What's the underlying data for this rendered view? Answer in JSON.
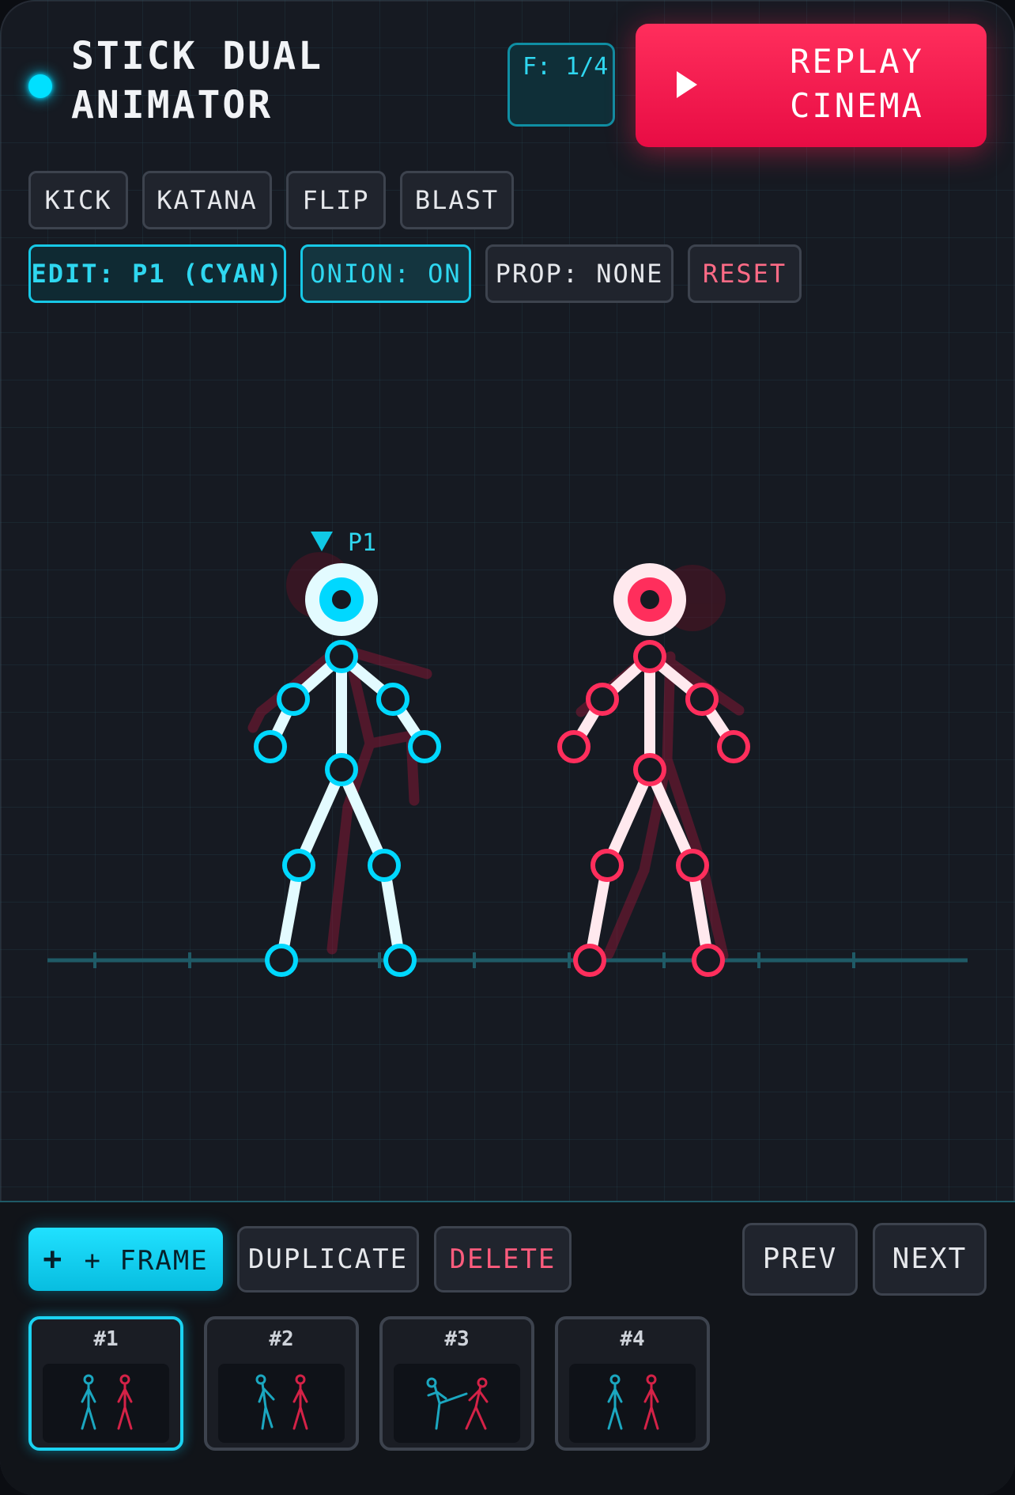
{
  "header": {
    "title": "STICK DUAL ANIMATOR",
    "frame_counter": "F: 1/4",
    "replay_label": "REPLAY CINEMA"
  },
  "moves": [
    {
      "label": "KICK"
    },
    {
      "label": "KATANA"
    },
    {
      "label": "FLIP"
    },
    {
      "label": "BLAST"
    }
  ],
  "controls": {
    "edit": "EDIT: P1 (CYAN)",
    "onion": "ONION: ON",
    "prop": "PROP: NONE",
    "reset": "RESET"
  },
  "stage": {
    "active_marker": "P1",
    "colors": {
      "p1": "#00d8ff",
      "p2": "#ff2e5c",
      "ground": "#1f5a66"
    }
  },
  "actions": {
    "add_frame": "+ FRAME",
    "duplicate": "DUPLICATE",
    "delete": "DELETE",
    "prev": "PREV",
    "next": "NEXT"
  },
  "frames": [
    {
      "label": "#1",
      "active": true
    },
    {
      "label": "#2",
      "active": false
    },
    {
      "label": "#3",
      "active": false
    },
    {
      "label": "#4",
      "active": false
    }
  ]
}
